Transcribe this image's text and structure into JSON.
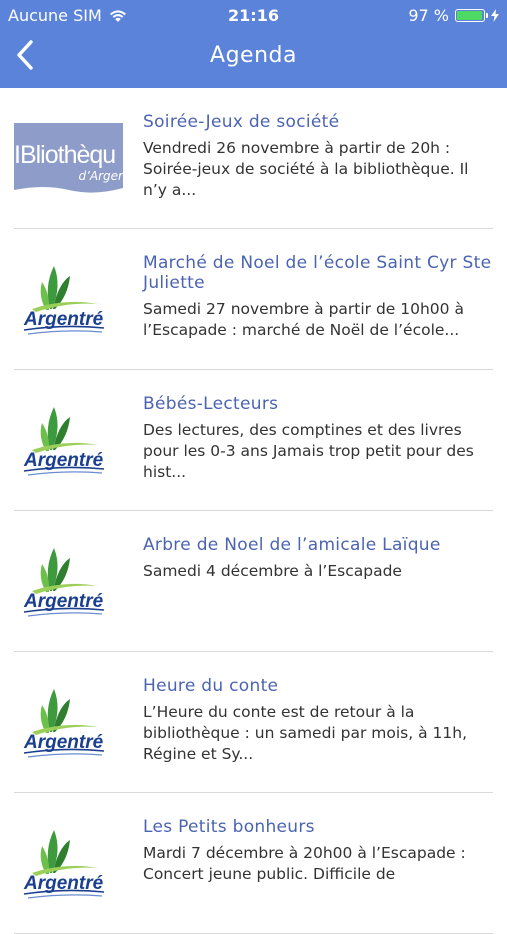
{
  "status": {
    "carrier": "Aucune SIM",
    "time": "21:16",
    "battery": "97 %",
    "battery_level": 0.97
  },
  "nav": {
    "title": "Agenda",
    "back_icon": "chevron-left-icon"
  },
  "events": [
    {
      "thumb": "bibliotheque",
      "title": "Soirée-Jeux de société",
      "desc": "Vendredi 26 novembre à partir de 20h : Soirée-jeux de société à la bibliothèque. Il n’y a..."
    },
    {
      "thumb": "argentre",
      "title": "Marché de Noel de l’école Saint Cyr Ste Juliette",
      "desc": "Samedi 27 novembre à partir de 10h00 à l’Escapade : marché de Noël de l’école..."
    },
    {
      "thumb": "argentre",
      "title": "Bébés-Lecteurs",
      "desc": "Des lectures, des comptines et des livres pour les 0-3 ans Jamais trop petit pour des hist..."
    },
    {
      "thumb": "argentre",
      "title": "Arbre de Noel de l’amicale Laïque",
      "desc": "Samedi 4 décembre à l’Escapade"
    },
    {
      "thumb": "argentre",
      "title": "Heure du conte",
      "desc": "L’Heure du conte est de retour à la bibliothèque : un samedi par mois, à 11h, Régine et Sy..."
    },
    {
      "thumb": "argentre",
      "title": "Les Petits bonheurs",
      "desc": "Mardi 7 décembre à 20h00 à l’Escapade : Concert jeune public. Difficile de"
    }
  ],
  "logos": {
    "bibliotheque_line1": "IBliothèqu",
    "bibliotheque_line2": "d’Arger",
    "argentre": "Argentré"
  },
  "colors": {
    "nav_bg": "#5b83d9",
    "title": "#4b64b1",
    "battery": "#4cd964",
    "logo_blue": "#1b3f8f",
    "logo_green": "#3aa23a"
  }
}
